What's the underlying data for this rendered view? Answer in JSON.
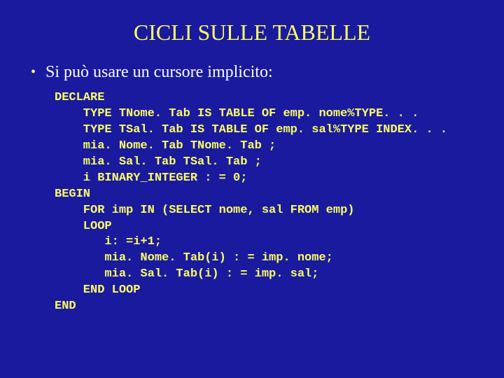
{
  "title": "CICLI SULLE TABELLE",
  "bullet": "Si può usare un cursore implicito:",
  "code": "DECLARE\n    TYPE TNome. Tab IS TABLE OF emp. nome%TYPE. . .\n    TYPE TSal. Tab IS TABLE OF emp. sal%TYPE INDEX. . .\n    mia. Nome. Tab TNome. Tab ;\n    mia. Sal. Tab TSal. Tab ;\n    i BINARY_INTEGER : = 0;\nBEGIN\n    FOR imp IN (SELECT nome, sal FROM emp)\n    LOOP\n       i: =i+1;\n       mia. Nome. Tab(i) : = imp. nome;\n       mia. Sal. Tab(i) : = imp. sal;\n    END LOOP\nEND"
}
